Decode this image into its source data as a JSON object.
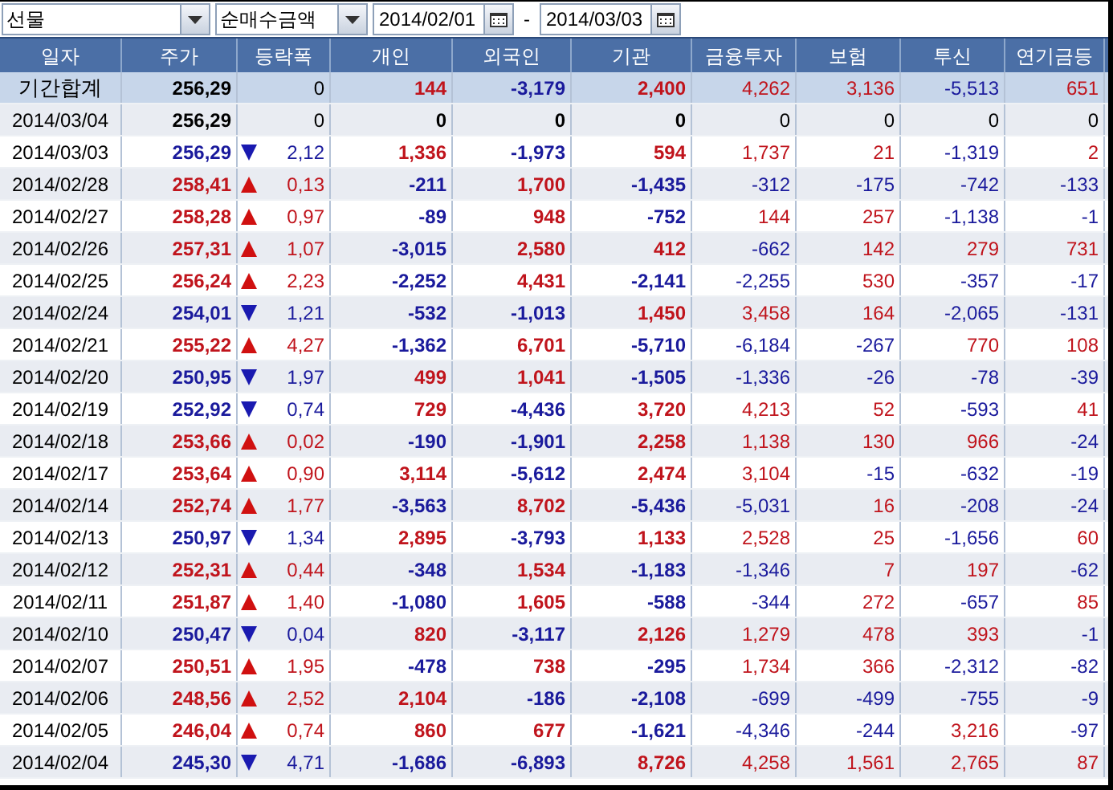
{
  "toolbar": {
    "market": "선물",
    "measure": "순매수금액",
    "date_from": "2014/02/01",
    "separator": "-",
    "date_to": "2014/03/03"
  },
  "table": {
    "columns": [
      "일자",
      "주가",
      "등락폭",
      "개인",
      "외국인",
      "기관",
      "금융투자",
      "보험",
      "투신",
      "연기금등"
    ],
    "rows": [
      {
        "kind": "total",
        "date": "기간합계",
        "price": "256,29",
        "rising": false,
        "falling": false,
        "change": "0",
        "values": [
          "144",
          "-3,179",
          "2,400",
          "4,262",
          "3,136",
          "-5,513",
          "651"
        ]
      },
      {
        "kind": "day",
        "date": "2014/03/04",
        "price": "256,29",
        "rising": false,
        "falling": false,
        "change": "0",
        "values": [
          "0",
          "0",
          "0",
          "0",
          "0",
          "0",
          "0"
        ]
      },
      {
        "kind": "day",
        "date": "2014/03/03",
        "price": "256,29",
        "rising": false,
        "falling": true,
        "change": "2,12",
        "values": [
          "1,336",
          "-1,973",
          "594",
          "1,737",
          "21",
          "-1,319",
          "2"
        ]
      },
      {
        "kind": "day",
        "date": "2014/02/28",
        "price": "258,41",
        "rising": true,
        "falling": false,
        "change": "0,13",
        "values": [
          "-211",
          "1,700",
          "-1,435",
          "-312",
          "-175",
          "-742",
          "-133"
        ]
      },
      {
        "kind": "day",
        "date": "2014/02/27",
        "price": "258,28",
        "rising": true,
        "falling": false,
        "change": "0,97",
        "values": [
          "-89",
          "948",
          "-752",
          "144",
          "257",
          "-1,138",
          "-1"
        ]
      },
      {
        "kind": "day",
        "date": "2014/02/26",
        "price": "257,31",
        "rising": true,
        "falling": false,
        "change": "1,07",
        "values": [
          "-3,015",
          "2,580",
          "412",
          "-662",
          "142",
          "279",
          "731"
        ]
      },
      {
        "kind": "day",
        "date": "2014/02/25",
        "price": "256,24",
        "rising": true,
        "falling": false,
        "change": "2,23",
        "values": [
          "-2,252",
          "4,431",
          "-2,141",
          "-2,255",
          "530",
          "-357",
          "-17"
        ]
      },
      {
        "kind": "day",
        "date": "2014/02/24",
        "price": "254,01",
        "rising": false,
        "falling": true,
        "change": "1,21",
        "values": [
          "-532",
          "-1,013",
          "1,450",
          "3,458",
          "164",
          "-2,065",
          "-131"
        ]
      },
      {
        "kind": "day",
        "date": "2014/02/21",
        "price": "255,22",
        "rising": true,
        "falling": false,
        "change": "4,27",
        "values": [
          "-1,362",
          "6,701",
          "-5,710",
          "-6,184",
          "-267",
          "770",
          "108"
        ]
      },
      {
        "kind": "day",
        "date": "2014/02/20",
        "price": "250,95",
        "rising": false,
        "falling": true,
        "change": "1,97",
        "values": [
          "499",
          "1,041",
          "-1,505",
          "-1,336",
          "-26",
          "-78",
          "-39"
        ]
      },
      {
        "kind": "day",
        "date": "2014/02/19",
        "price": "252,92",
        "rising": false,
        "falling": true,
        "change": "0,74",
        "values": [
          "729",
          "-4,436",
          "3,720",
          "4,213",
          "52",
          "-593",
          "41"
        ]
      },
      {
        "kind": "day",
        "date": "2014/02/18",
        "price": "253,66",
        "rising": true,
        "falling": false,
        "change": "0,02",
        "values": [
          "-190",
          "-1,901",
          "2,258",
          "1,138",
          "130",
          "966",
          "-24"
        ]
      },
      {
        "kind": "day",
        "date": "2014/02/17",
        "price": "253,64",
        "rising": true,
        "falling": false,
        "change": "0,90",
        "values": [
          "3,114",
          "-5,612",
          "2,474",
          "3,104",
          "-15",
          "-632",
          "-19"
        ]
      },
      {
        "kind": "day",
        "date": "2014/02/14",
        "price": "252,74",
        "rising": true,
        "falling": false,
        "change": "1,77",
        "values": [
          "-3,563",
          "8,702",
          "-5,436",
          "-5,031",
          "16",
          "-208",
          "-24"
        ]
      },
      {
        "kind": "day",
        "date": "2014/02/13",
        "price": "250,97",
        "rising": false,
        "falling": true,
        "change": "1,34",
        "values": [
          "2,895",
          "-3,793",
          "1,133",
          "2,528",
          "25",
          "-1,656",
          "60"
        ]
      },
      {
        "kind": "day",
        "date": "2014/02/12",
        "price": "252,31",
        "rising": true,
        "falling": false,
        "change": "0,44",
        "values": [
          "-348",
          "1,534",
          "-1,183",
          "-1,346",
          "7",
          "197",
          "-62"
        ]
      },
      {
        "kind": "day",
        "date": "2014/02/11",
        "price": "251,87",
        "rising": true,
        "falling": false,
        "change": "1,40",
        "values": [
          "-1,080",
          "1,605",
          "-588",
          "-344",
          "272",
          "-657",
          "85"
        ]
      },
      {
        "kind": "day",
        "date": "2014/02/10",
        "price": "250,47",
        "rising": false,
        "falling": true,
        "change": "0,04",
        "values": [
          "820",
          "-3,117",
          "2,126",
          "1,279",
          "478",
          "393",
          "-1"
        ]
      },
      {
        "kind": "day",
        "date": "2014/02/07",
        "price": "250,51",
        "rising": true,
        "falling": false,
        "change": "1,95",
        "values": [
          "-478",
          "738",
          "-295",
          "1,734",
          "366",
          "-2,312",
          "-82"
        ]
      },
      {
        "kind": "day",
        "date": "2014/02/06",
        "price": "248,56",
        "rising": true,
        "falling": false,
        "change": "2,52",
        "values": [
          "2,104",
          "-186",
          "-2,108",
          "-699",
          "-499",
          "-755",
          "-9"
        ]
      },
      {
        "kind": "day",
        "date": "2014/02/05",
        "price": "246,04",
        "rising": true,
        "falling": false,
        "change": "0,74",
        "values": [
          "860",
          "677",
          "-1,621",
          "-4,346",
          "-244",
          "3,216",
          "-97"
        ]
      },
      {
        "kind": "day",
        "date": "2014/02/04",
        "price": "245,30",
        "rising": false,
        "falling": true,
        "change": "4,71",
        "values": [
          "-1,686",
          "-6,893",
          "8,726",
          "4,258",
          "1,561",
          "2,765",
          "87"
        ]
      }
    ]
  }
}
